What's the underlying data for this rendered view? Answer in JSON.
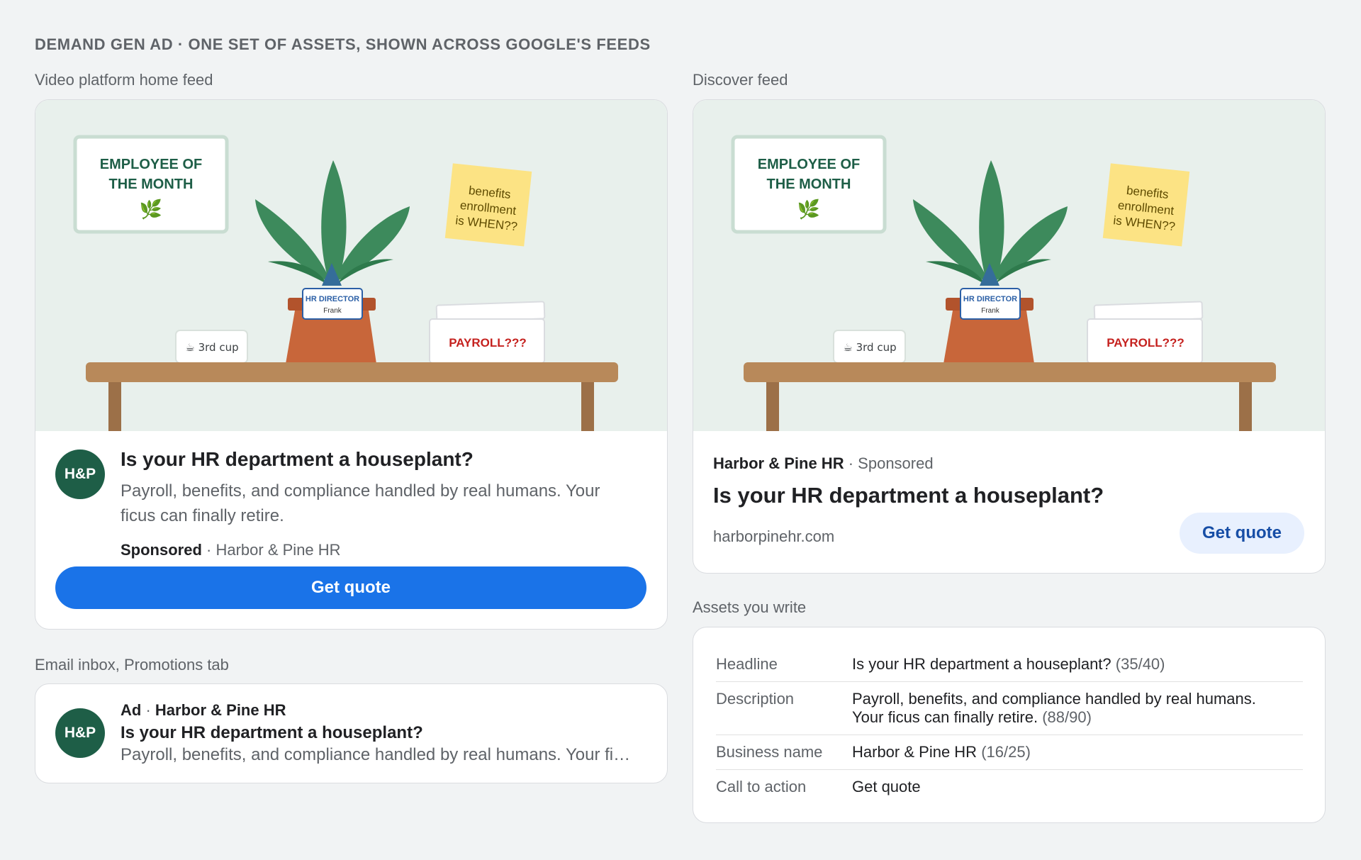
{
  "page_title": "DEMAND GEN AD · ONE SET OF ASSETS, SHOWN ACROSS GOOGLE'S FEEDS",
  "sections": {
    "video": "Video platform home feed",
    "discover": "Discover feed",
    "email": "Email inbox, Promotions tab",
    "assets": "Assets you write"
  },
  "illustration": {
    "frame_line1": "EMPLOYEE OF",
    "frame_line2": "THE MONTH",
    "frame_emoji": "🌿",
    "sticky_line1": "benefits",
    "sticky_line2": "enrollment",
    "sticky_line3": "is WHEN??",
    "badge_title": "HR DIRECTOR",
    "badge_name": "Frank",
    "mug_label": "☕ 3rd cup",
    "tray_label": "PAYROLL???"
  },
  "ad": {
    "logo_text": "H&P",
    "headline": "Is your HR department a houseplant?",
    "description": "Payroll, benefits, and compliance handled by real humans. Your ficus can finally retire.",
    "sponsored": "Sponsored",
    "separator": "·",
    "business_name": "Harbor & Pine HR",
    "cta": "Get quote",
    "domain": "harborpinehr.com",
    "ad_label": "Ad"
  },
  "assets": [
    {
      "key": "Headline",
      "value": "Is your HR department a houseplant?",
      "count": "(35/40)"
    },
    {
      "key": "Description",
      "value": "Payroll, benefits, and compliance handled by real humans. Your ficus can finally retire.",
      "count": "(88/90)"
    },
    {
      "key": "Business name",
      "value": "Harbor & Pine HR",
      "count": "(16/25)"
    },
    {
      "key": "Call to action",
      "value": "Get quote",
      "count": ""
    }
  ],
  "colors": {
    "brand_green": "#1e5e47",
    "primary_blue": "#1a73e8",
    "tonal_bg": "#e8f0fe",
    "illustration_bg": "#e8f0ec",
    "pot": "#c8663a",
    "desk": "#b8895a"
  }
}
